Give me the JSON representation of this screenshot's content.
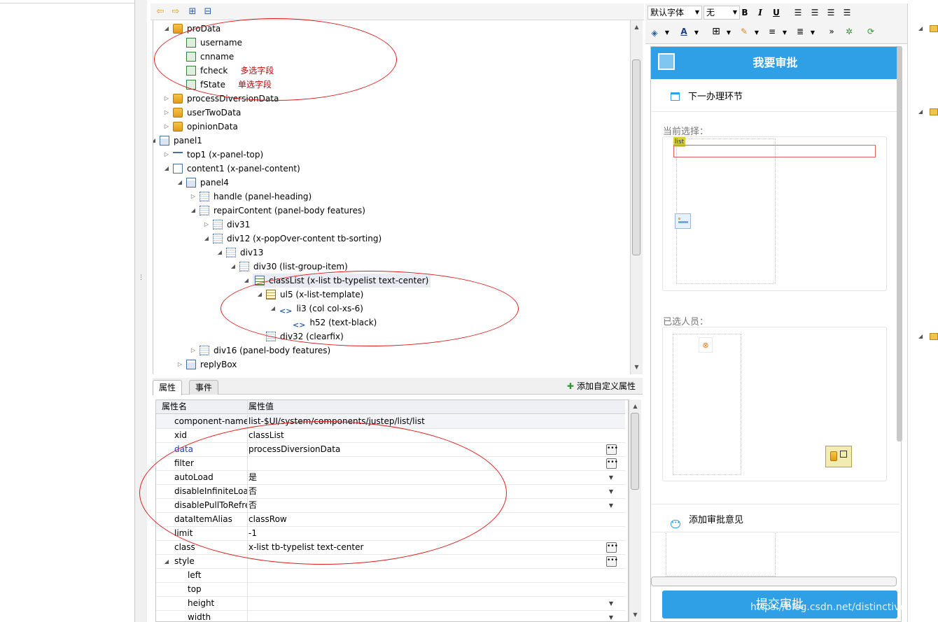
{
  "toolbar": {
    "back": "⇦",
    "forward": "⇨",
    "expand": "⊞",
    "collapse": "⊟"
  },
  "tree": {
    "nodes": [
      {
        "label": "proData",
        "icon": "data",
        "note": ""
      },
      {
        "label": "username",
        "icon": "field",
        "note": ""
      },
      {
        "label": "cnname",
        "icon": "field",
        "note": ""
      },
      {
        "label": "fcheck",
        "icon": "field",
        "note": "多选字段"
      },
      {
        "label": "fState",
        "icon": "field",
        "note": "单选字段"
      },
      {
        "label": "processDiversionData",
        "icon": "data",
        "note": ""
      },
      {
        "label": "userTwoData",
        "icon": "data",
        "note": ""
      },
      {
        "label": "opinionData",
        "icon": "data",
        "note": ""
      },
      {
        "label": "panel1",
        "icon": "panel",
        "note": ""
      },
      {
        "label": "top1 (x-panel-top)",
        "icon": "top",
        "note": ""
      },
      {
        "label": "content1 (x-panel-content)",
        "icon": "content",
        "note": ""
      },
      {
        "label": "panel4",
        "icon": "panel",
        "note": ""
      },
      {
        "label": "handle (panel-heading)",
        "icon": "div",
        "note": ""
      },
      {
        "label": "repairContent (panel-body features)",
        "icon": "div",
        "note": ""
      },
      {
        "label": "div31",
        "icon": "div",
        "note": ""
      },
      {
        "label": "div12 (x-popOver-content tb-sorting)",
        "icon": "div",
        "note": ""
      },
      {
        "label": "div13",
        "icon": "div",
        "note": ""
      },
      {
        "label": "div30 (list-group-item)",
        "icon": "div",
        "note": ""
      },
      {
        "label": "classList (x-list tb-typelist text-center)",
        "icon": "list",
        "note": ""
      },
      {
        "label": "ul5 (x-list-template)",
        "icon": "ul",
        "note": ""
      },
      {
        "label": "li3 (col col-xs-6)",
        "icon": "code",
        "note": ""
      },
      {
        "label": "h52 (text-black)",
        "icon": "code",
        "note": ""
      },
      {
        "label": "div32 (clearfix)",
        "icon": "div",
        "note": ""
      },
      {
        "label": "div16 (panel-body features)",
        "icon": "div",
        "note": ""
      },
      {
        "label": "replyBox",
        "icon": "panel",
        "note": ""
      }
    ]
  },
  "tabs": {
    "properties": "属性",
    "events": "事件",
    "add_custom": "添加自定义属性"
  },
  "props": {
    "header_name": "属性名",
    "header_value": "属性值",
    "rows": [
      {
        "name": "component-name",
        "value": "list-$UI/system/components/justep/list/list",
        "ctrl": "",
        "blue": false
      },
      {
        "name": "xid",
        "value": "classList",
        "ctrl": "",
        "blue": false
      },
      {
        "name": "data",
        "value": "processDiversionData",
        "ctrl": "btn",
        "blue": true
      },
      {
        "name": "filter",
        "value": "",
        "ctrl": "btn",
        "blue": false
      },
      {
        "name": "autoLoad",
        "value": "是",
        "ctrl": "drop",
        "blue": false
      },
      {
        "name": "disableInfiniteLoad",
        "value": "否",
        "ctrl": "drop",
        "blue": false
      },
      {
        "name": "disablePullToRefresh",
        "value": "否",
        "ctrl": "drop",
        "blue": false
      },
      {
        "name": "dataItemAlias",
        "value": "classRow",
        "ctrl": "",
        "blue": false
      },
      {
        "name": "limit",
        "value": "-1",
        "ctrl": "",
        "blue": false
      },
      {
        "name": "class",
        "value": "x-list tb-typelist text-center",
        "ctrl": "btn",
        "blue": false
      },
      {
        "name": "style",
        "value": "",
        "ctrl": "btn",
        "blue": false
      },
      {
        "name": "left",
        "value": "",
        "ctrl": "",
        "blue": false
      },
      {
        "name": "top",
        "value": "",
        "ctrl": "",
        "blue": false
      },
      {
        "name": "height",
        "value": "",
        "ctrl": "drop",
        "blue": false
      },
      {
        "name": "width",
        "value": "",
        "ctrl": "drop",
        "blue": false
      }
    ]
  },
  "editor": {
    "font_select": "默认字体",
    "size_select": "无",
    "bold": "B",
    "italic": "I",
    "underline": "U",
    "font_color": "A",
    "more": "»"
  },
  "phone": {
    "title": "我要审批",
    "next_step": "下一办理环节",
    "current_choice": "当前选择：",
    "list_tag": "list",
    "selected_people": "已选人员：",
    "add_opinion": "添加审批意见",
    "submit": "提交审批"
  },
  "watermark": "https://blog.csdn.net/distinctive_MAN",
  "colors": {
    "accent": "#2fa0e5",
    "annotation": "#e01b1b",
    "note_text": "#c00000"
  }
}
